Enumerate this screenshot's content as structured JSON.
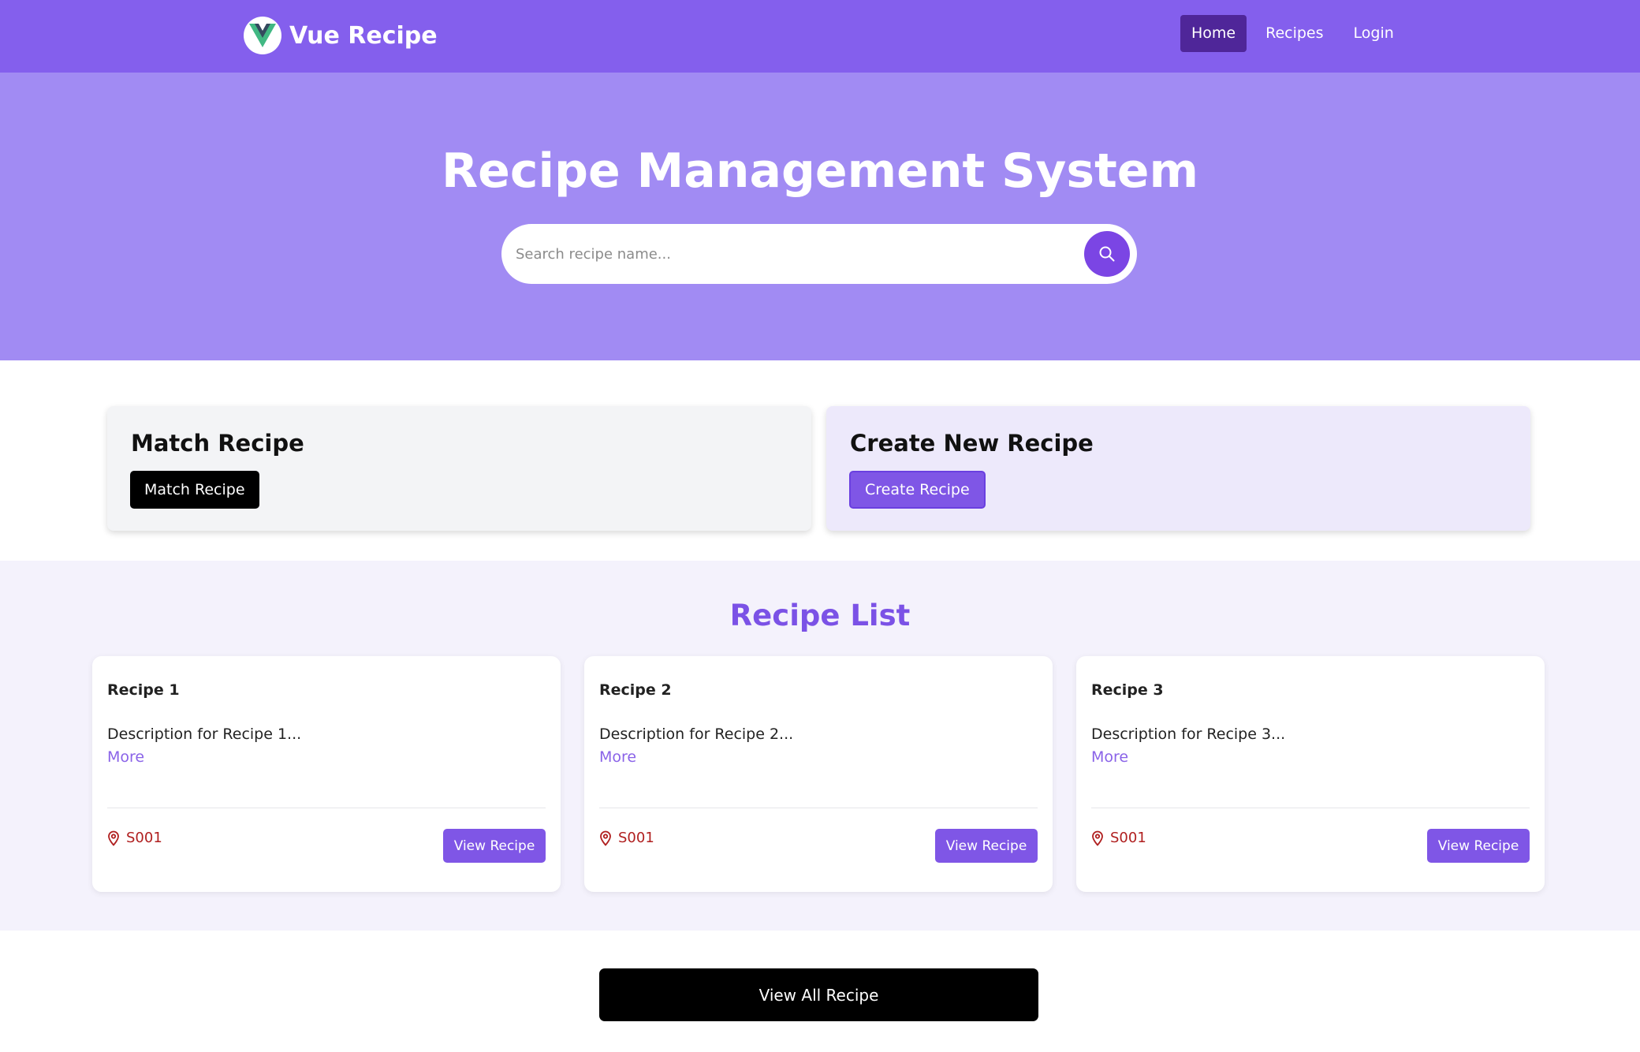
{
  "navbar": {
    "brand": "Vue Recipe",
    "links": [
      {
        "label": "Home",
        "active": true
      },
      {
        "label": "Recipes",
        "active": false
      },
      {
        "label": "Login",
        "active": false
      }
    ]
  },
  "hero": {
    "title": "Recipe Management System",
    "search_placeholder": "Search recipe name..."
  },
  "actions": {
    "match": {
      "title": "Match Recipe",
      "button": "Match Recipe"
    },
    "create": {
      "title": "Create New Recipe",
      "button": "Create Recipe"
    }
  },
  "recipe_list": {
    "heading": "Recipe List",
    "recipes": [
      {
        "title": "Recipe 1",
        "description": "Description for Recipe 1...",
        "more": "More",
        "location": "S001",
        "button": "View Recipe"
      },
      {
        "title": "Recipe 2",
        "description": "Description for Recipe 2...",
        "more": "More",
        "location": "S001",
        "button": "View Recipe"
      },
      {
        "title": "Recipe 3",
        "description": "Description for Recipe 3...",
        "more": "More",
        "location": "S001",
        "button": "View Recipe"
      }
    ]
  },
  "view_all": "View All Recipe",
  "colors": {
    "navbar": "#845fed",
    "hero": "#a18bf3",
    "accent": "#7f56e6",
    "location": "#b01f1f"
  }
}
